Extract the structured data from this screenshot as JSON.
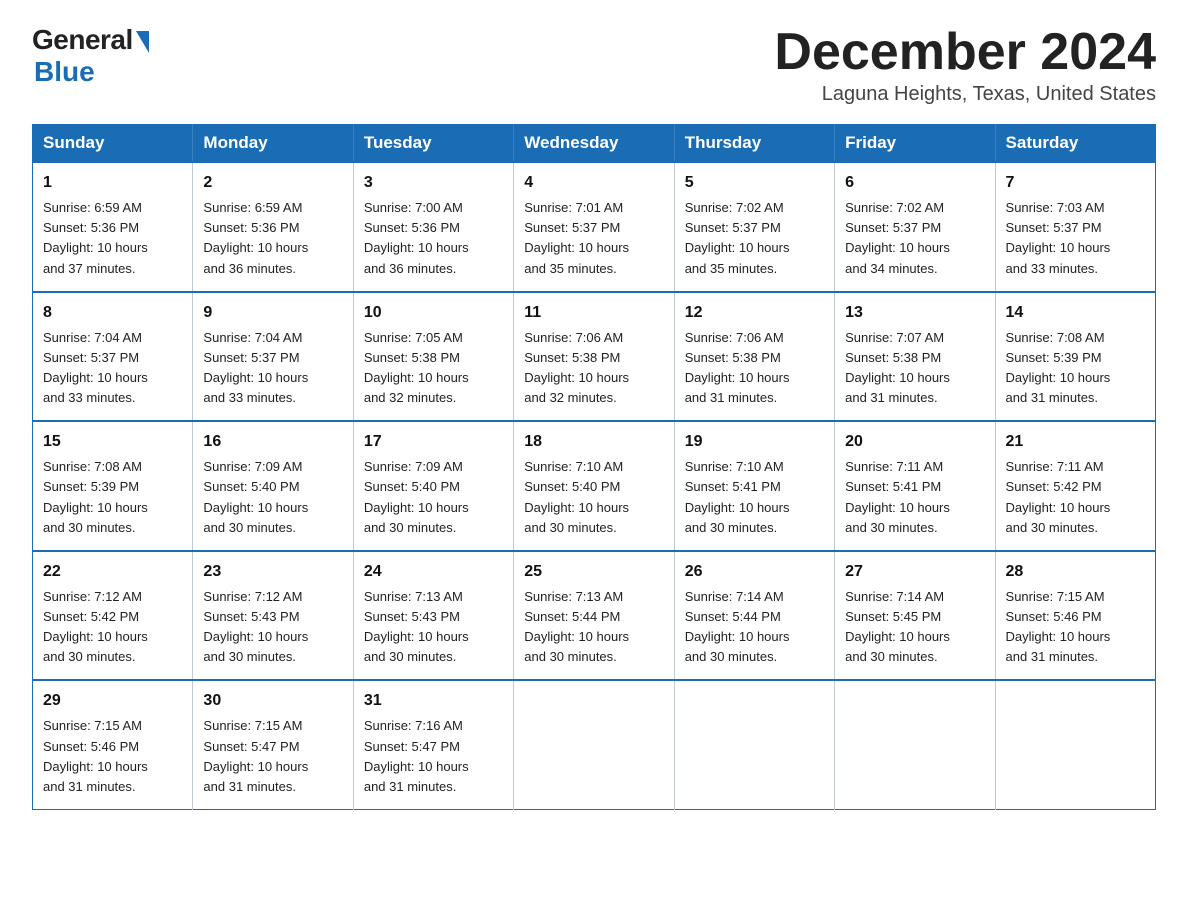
{
  "logo": {
    "general": "General",
    "blue": "Blue"
  },
  "title": "December 2024",
  "location": "Laguna Heights, Texas, United States",
  "weekdays": [
    "Sunday",
    "Monday",
    "Tuesday",
    "Wednesday",
    "Thursday",
    "Friday",
    "Saturday"
  ],
  "weeks": [
    [
      {
        "day": "1",
        "sunrise": "6:59 AM",
        "sunset": "5:36 PM",
        "daylight": "10 hours and 37 minutes."
      },
      {
        "day": "2",
        "sunrise": "6:59 AM",
        "sunset": "5:36 PM",
        "daylight": "10 hours and 36 minutes."
      },
      {
        "day": "3",
        "sunrise": "7:00 AM",
        "sunset": "5:36 PM",
        "daylight": "10 hours and 36 minutes."
      },
      {
        "day": "4",
        "sunrise": "7:01 AM",
        "sunset": "5:37 PM",
        "daylight": "10 hours and 35 minutes."
      },
      {
        "day": "5",
        "sunrise": "7:02 AM",
        "sunset": "5:37 PM",
        "daylight": "10 hours and 35 minutes."
      },
      {
        "day": "6",
        "sunrise": "7:02 AM",
        "sunset": "5:37 PM",
        "daylight": "10 hours and 34 minutes."
      },
      {
        "day": "7",
        "sunrise": "7:03 AM",
        "sunset": "5:37 PM",
        "daylight": "10 hours and 33 minutes."
      }
    ],
    [
      {
        "day": "8",
        "sunrise": "7:04 AM",
        "sunset": "5:37 PM",
        "daylight": "10 hours and 33 minutes."
      },
      {
        "day": "9",
        "sunrise": "7:04 AM",
        "sunset": "5:37 PM",
        "daylight": "10 hours and 33 minutes."
      },
      {
        "day": "10",
        "sunrise": "7:05 AM",
        "sunset": "5:38 PM",
        "daylight": "10 hours and 32 minutes."
      },
      {
        "day": "11",
        "sunrise": "7:06 AM",
        "sunset": "5:38 PM",
        "daylight": "10 hours and 32 minutes."
      },
      {
        "day": "12",
        "sunrise": "7:06 AM",
        "sunset": "5:38 PM",
        "daylight": "10 hours and 31 minutes."
      },
      {
        "day": "13",
        "sunrise": "7:07 AM",
        "sunset": "5:38 PM",
        "daylight": "10 hours and 31 minutes."
      },
      {
        "day": "14",
        "sunrise": "7:08 AM",
        "sunset": "5:39 PM",
        "daylight": "10 hours and 31 minutes."
      }
    ],
    [
      {
        "day": "15",
        "sunrise": "7:08 AM",
        "sunset": "5:39 PM",
        "daylight": "10 hours and 30 minutes."
      },
      {
        "day": "16",
        "sunrise": "7:09 AM",
        "sunset": "5:40 PM",
        "daylight": "10 hours and 30 minutes."
      },
      {
        "day": "17",
        "sunrise": "7:09 AM",
        "sunset": "5:40 PM",
        "daylight": "10 hours and 30 minutes."
      },
      {
        "day": "18",
        "sunrise": "7:10 AM",
        "sunset": "5:40 PM",
        "daylight": "10 hours and 30 minutes."
      },
      {
        "day": "19",
        "sunrise": "7:10 AM",
        "sunset": "5:41 PM",
        "daylight": "10 hours and 30 minutes."
      },
      {
        "day": "20",
        "sunrise": "7:11 AM",
        "sunset": "5:41 PM",
        "daylight": "10 hours and 30 minutes."
      },
      {
        "day": "21",
        "sunrise": "7:11 AM",
        "sunset": "5:42 PM",
        "daylight": "10 hours and 30 minutes."
      }
    ],
    [
      {
        "day": "22",
        "sunrise": "7:12 AM",
        "sunset": "5:42 PM",
        "daylight": "10 hours and 30 minutes."
      },
      {
        "day": "23",
        "sunrise": "7:12 AM",
        "sunset": "5:43 PM",
        "daylight": "10 hours and 30 minutes."
      },
      {
        "day": "24",
        "sunrise": "7:13 AM",
        "sunset": "5:43 PM",
        "daylight": "10 hours and 30 minutes."
      },
      {
        "day": "25",
        "sunrise": "7:13 AM",
        "sunset": "5:44 PM",
        "daylight": "10 hours and 30 minutes."
      },
      {
        "day": "26",
        "sunrise": "7:14 AM",
        "sunset": "5:44 PM",
        "daylight": "10 hours and 30 minutes."
      },
      {
        "day": "27",
        "sunrise": "7:14 AM",
        "sunset": "5:45 PM",
        "daylight": "10 hours and 30 minutes."
      },
      {
        "day": "28",
        "sunrise": "7:15 AM",
        "sunset": "5:46 PM",
        "daylight": "10 hours and 31 minutes."
      }
    ],
    [
      {
        "day": "29",
        "sunrise": "7:15 AM",
        "sunset": "5:46 PM",
        "daylight": "10 hours and 31 minutes."
      },
      {
        "day": "30",
        "sunrise": "7:15 AM",
        "sunset": "5:47 PM",
        "daylight": "10 hours and 31 minutes."
      },
      {
        "day": "31",
        "sunrise": "7:16 AM",
        "sunset": "5:47 PM",
        "daylight": "10 hours and 31 minutes."
      },
      null,
      null,
      null,
      null
    ]
  ],
  "labels": {
    "sunrise": "Sunrise:",
    "sunset": "Sunset:",
    "daylight": "Daylight:"
  }
}
